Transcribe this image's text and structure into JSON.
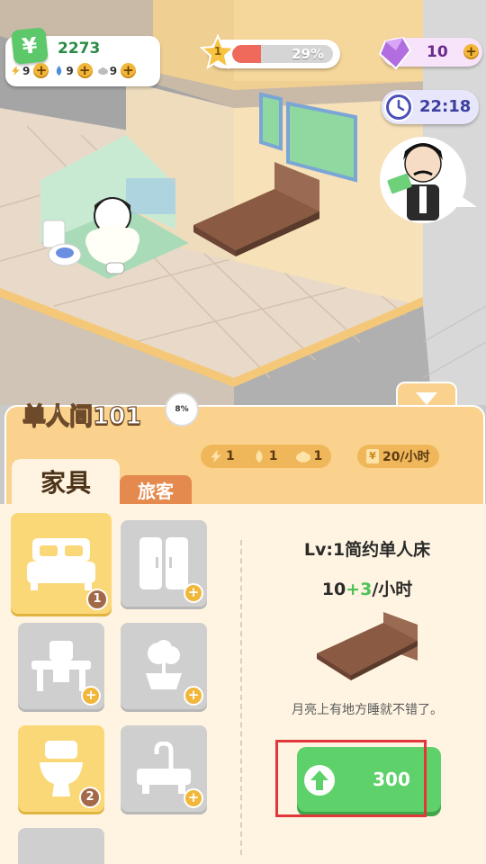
{
  "hud": {
    "money": "2273",
    "resources": [
      {
        "name": "energy",
        "value": "9"
      },
      {
        "name": "water",
        "value": "9"
      },
      {
        "name": "cloud",
        "value": "9"
      }
    ],
    "level": "1",
    "level_progress": "29%",
    "level_fraction": 0.29,
    "gems": "10",
    "clock": "22:18"
  },
  "panel": {
    "room_title": "单人间101",
    "room_badge": "8%",
    "stats": {
      "energy": "1",
      "water": "1",
      "cloud": "1",
      "income": "20/小时"
    },
    "tabs": {
      "furniture": "家具",
      "guests": "旅客"
    },
    "cards": [
      {
        "item": "bed",
        "count": "1"
      },
      {
        "item": "wardrobe"
      },
      {
        "item": "desk"
      },
      {
        "item": "plant"
      },
      {
        "item": "toilet",
        "count": "2"
      },
      {
        "item": "sink"
      }
    ],
    "detail": {
      "name": "Lv:1简约单人床",
      "rate_base": "10",
      "rate_bonus": "+3",
      "rate_unit": "/小时",
      "description": "月亮上有地方睡就不错了。",
      "upgrade_cost": "300"
    }
  },
  "colors": {
    "panel": "#fad28d",
    "body": "#fff4e2",
    "green": "#5fd16a",
    "highlight": "#e0383a"
  }
}
